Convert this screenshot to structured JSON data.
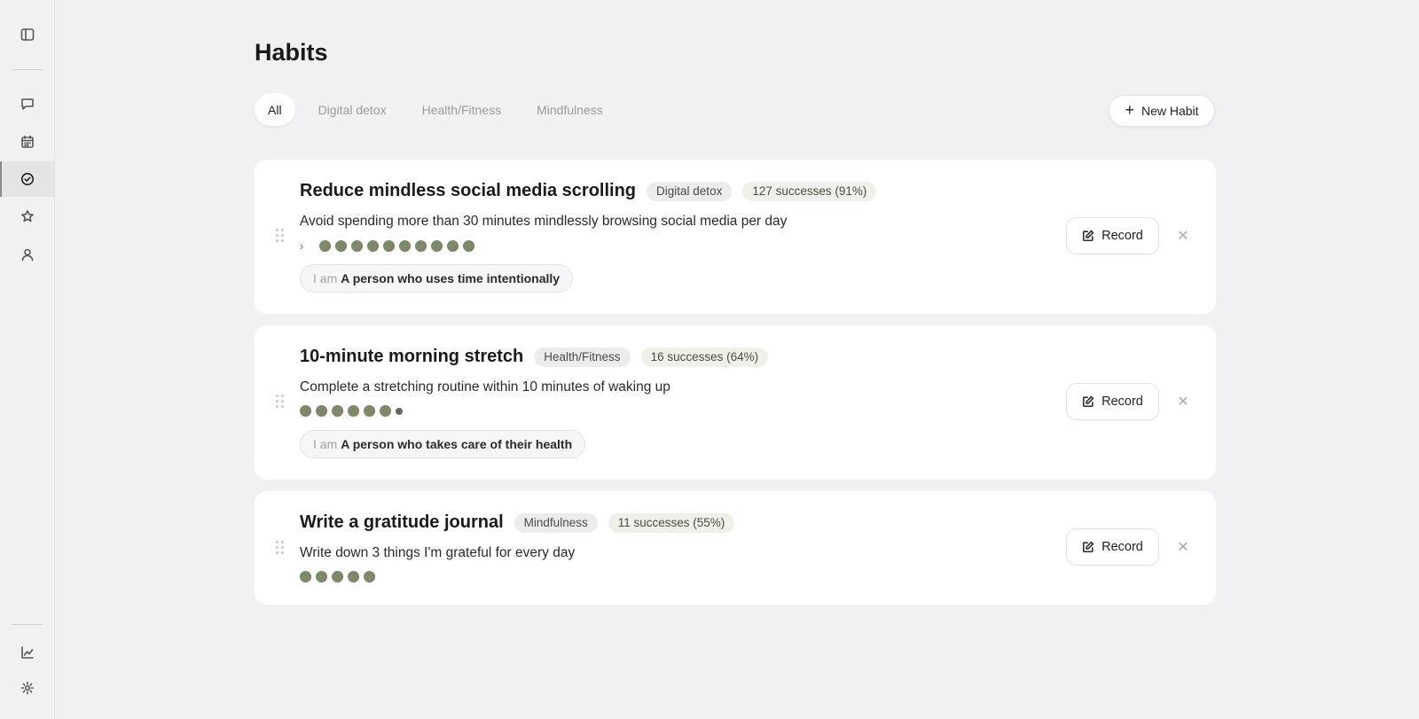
{
  "page": {
    "title": "Habits"
  },
  "sidebar": {
    "items": [
      {
        "name": "sidebar-toggle",
        "icon": "sidebar-panel-icon"
      },
      {
        "name": "sidebar-item-chat",
        "icon": "chat-bubble-icon"
      },
      {
        "name": "sidebar-item-calendar",
        "icon": "calendar-icon"
      },
      {
        "name": "sidebar-item-habits",
        "icon": "check-circle-icon",
        "active": true
      },
      {
        "name": "sidebar-item-favorites",
        "icon": "star-icon"
      },
      {
        "name": "sidebar-item-profile",
        "icon": "user-icon"
      },
      {
        "name": "sidebar-item-stats",
        "icon": "line-chart-icon"
      },
      {
        "name": "sidebar-item-settings",
        "icon": "gear-icon"
      }
    ]
  },
  "tabs": [
    {
      "label": "All",
      "active": true
    },
    {
      "label": "Digital detox"
    },
    {
      "label": "Health/Fitness"
    },
    {
      "label": "Mindfulness"
    }
  ],
  "new_habit_label": "New Habit",
  "record_label": "Record",
  "identity_prefix": "I am",
  "habits": [
    {
      "title": "Reduce mindless social media scrolling",
      "category": "Digital detox",
      "successes": "127 successes (91%)",
      "description": "Avoid spending more than 30 minutes mindlessly browsing social media per day",
      "dots": 10,
      "expandable": true,
      "identity": "A person who uses time intentionally"
    },
    {
      "title": "10-minute morning stretch",
      "category": "Health/Fitness",
      "successes": "16 successes (64%)",
      "description": "Complete a stretching routine within 10 minutes of waking up",
      "dots": 6,
      "small_dot": true,
      "identity": "A person who takes care of their health"
    },
    {
      "title": "Write a gratitude journal",
      "category": "Mindfulness",
      "successes": "11 successes (55%)",
      "description": "Write down 3 things I'm grateful for every day",
      "dots": 5
    }
  ],
  "colors": {
    "background": "#f1f1f4",
    "card": "#ffffff",
    "dot": "#7b8a6a",
    "success_badge": "#eef0ea"
  }
}
